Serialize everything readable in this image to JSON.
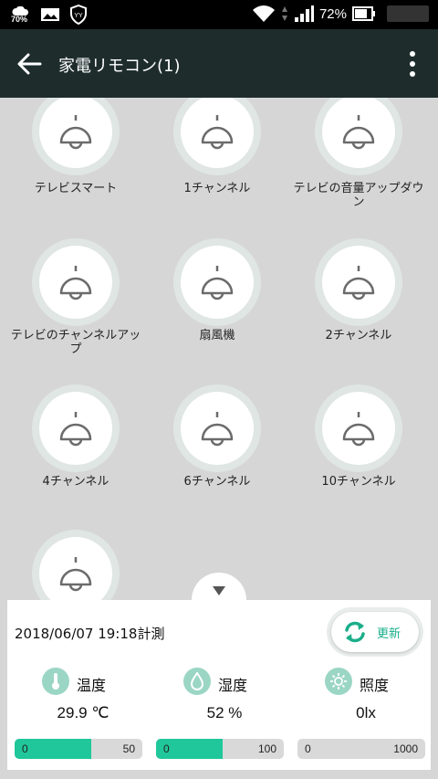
{
  "status_bar": {
    "left_battery_percent": "70%",
    "battery_percent": "72%"
  },
  "app_bar": {
    "title": "家電リモコン(1)"
  },
  "remote_buttons": [
    {
      "label": "テレビスマート"
    },
    {
      "label": "1チャンネル"
    },
    {
      "label": "テレビの音量アップダウン"
    },
    {
      "label": "テレビのチャンネルアップ"
    },
    {
      "label": "扇風機"
    },
    {
      "label": "2チャンネル"
    },
    {
      "label": "4チャンネル"
    },
    {
      "label": "6チャンネル"
    },
    {
      "label": "10チャンネル"
    },
    {
      "label": ""
    }
  ],
  "panel": {
    "measured_at": "2018/06/07 19:18計測",
    "refresh_label": "更新",
    "sensors": [
      {
        "name": "温度",
        "value": "29.9 ℃",
        "min": "0",
        "max": "50",
        "level": 0.598
      },
      {
        "name": "湿度",
        "value": "52 %",
        "min": "0",
        "max": "100",
        "level": 0.52
      },
      {
        "name": "照度",
        "value": "0lx",
        "min": "0",
        "max": "1000",
        "level": 0
      }
    ]
  },
  "colors": {
    "app_bar": "#1e2d2c",
    "accent": "#20c79a",
    "icon_bg": "#9bd6c4"
  }
}
